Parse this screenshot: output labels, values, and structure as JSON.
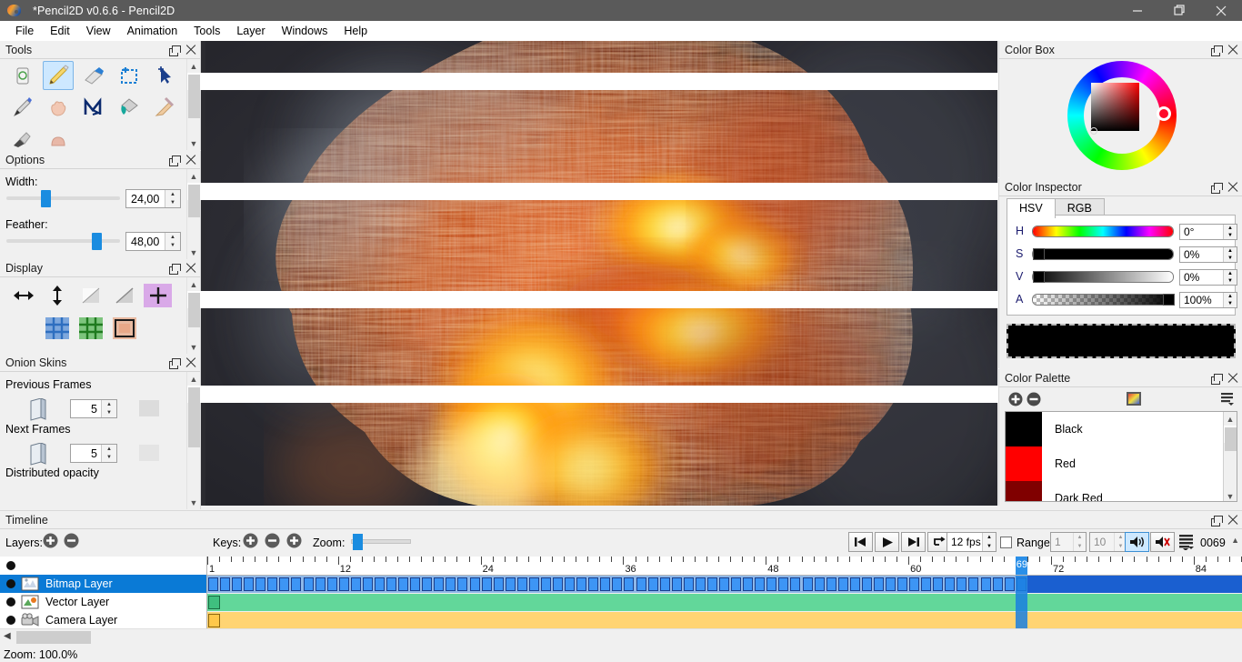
{
  "window": {
    "title": "*Pencil2D v0.6.6 - Pencil2D",
    "minimize_label": "minimize",
    "maximize_label": "restore",
    "close_label": "close"
  },
  "menubar": {
    "items": [
      {
        "label": "File"
      },
      {
        "label": "Edit"
      },
      {
        "label": "View"
      },
      {
        "label": "Animation"
      },
      {
        "label": "Tools"
      },
      {
        "label": "Layer"
      },
      {
        "label": "Windows"
      },
      {
        "label": "Help"
      }
    ]
  },
  "tools_panel": {
    "title": "Tools",
    "selected": "pencil",
    "items": [
      {
        "name": "clear-tool",
        "icon": "trash-icon"
      },
      {
        "name": "pencil-tool",
        "icon": "pencil-icon"
      },
      {
        "name": "eraser-tool",
        "icon": "eraser-icon"
      },
      {
        "name": "select-tool",
        "icon": "marquee-icon"
      },
      {
        "name": "move-tool",
        "icon": "cursor-icon"
      },
      {
        "name": "pen-tool",
        "icon": "pen-nib-icon"
      },
      {
        "name": "hand-tool",
        "icon": "hand-icon"
      },
      {
        "name": "polyline-tool",
        "icon": "polyline-icon"
      },
      {
        "name": "bucket-tool",
        "icon": "paint-bucket-icon"
      },
      {
        "name": "eyedropper-tool",
        "icon": "eyedropper-icon"
      },
      {
        "name": "brush-tool",
        "icon": "brush-icon"
      },
      {
        "name": "smudge-tool",
        "icon": "smudge-icon"
      }
    ]
  },
  "options_panel": {
    "title": "Options",
    "width_label": "Width:",
    "width_value": "24,00",
    "width_percent": 22,
    "feather_label": "Feather:",
    "feather_value": "48,00",
    "feather_percent": 74
  },
  "display_panel": {
    "title": "Display",
    "row1": [
      {
        "name": "flip-horizontal-button",
        "icon": "arrows-horizontal-icon",
        "active": false
      },
      {
        "name": "flip-vertical-button",
        "icon": "arrows-vertical-icon",
        "active": false
      },
      {
        "name": "mirror-button",
        "icon": "triangle-light-icon",
        "active": false
      },
      {
        "name": "mirror-diagonal-button",
        "icon": "triangle-line-icon",
        "active": false
      },
      {
        "name": "center-cross-button",
        "icon": "plus-icon",
        "active": true
      }
    ],
    "row2": [
      {
        "name": "grid-blue-button",
        "icon": "grid-blue-icon",
        "active": false
      },
      {
        "name": "grid-green-button",
        "icon": "grid-green-icon",
        "active": false
      },
      {
        "name": "safe-area-button",
        "icon": "frame-icon",
        "active": false
      }
    ]
  },
  "onion_panel": {
    "title": "Onion Skins",
    "previous_label": "Previous Frames",
    "previous_value": "5",
    "next_label": "Next Frames",
    "next_value": "5",
    "distributed_label": "Distributed opacity"
  },
  "color_box": {
    "title": "Color Box",
    "hue_marker_color": "#ff0a2a"
  },
  "color_inspector": {
    "title": "Color Inspector",
    "tabs": [
      {
        "label": "HSV",
        "active": true
      },
      {
        "label": "RGB",
        "active": false
      }
    ],
    "rows": [
      {
        "key": "H",
        "value": "0°",
        "kind": "hue"
      },
      {
        "key": "S",
        "value": "0%",
        "kind": "sat"
      },
      {
        "key": "V",
        "value": "0%",
        "kind": "val"
      },
      {
        "key": "A",
        "value": "100%",
        "kind": "alpha"
      }
    ],
    "preview_color": "#000000"
  },
  "color_palette": {
    "title": "Color Palette",
    "add_label": "add-color",
    "remove_label": "remove-color",
    "colors": [
      {
        "name": "Black",
        "hex": "#000000"
      },
      {
        "name": "Red",
        "hex": "#ff0000"
      },
      {
        "name": "Dark Red",
        "hex": "#800000"
      }
    ]
  },
  "timeline": {
    "title": "Timeline",
    "layers_label": "Layers:",
    "keys_label": "Keys:",
    "zoom_label": "Zoom:",
    "zoom_percent": 5,
    "fps_value": "12 fps",
    "range_label": "Range",
    "range_checked": false,
    "range_start": "1",
    "range_end": "10",
    "frame_counter": "0069",
    "current_frame": 69,
    "sound_on": true,
    "ruler_marks": [
      "1",
      "12",
      "24",
      "36",
      "48",
      "60",
      "72",
      "84"
    ],
    "layers": [
      {
        "name": "Bitmap Layer",
        "icon": "bitmap-layer-icon",
        "selected": true,
        "visible": true,
        "track_color": "#3d95f5",
        "kind": "keyframes"
      },
      {
        "name": "Vector Layer",
        "icon": "vector-layer-icon",
        "selected": false,
        "visible": true,
        "track_color": "#62d79a",
        "kind": "single"
      },
      {
        "name": "Camera Layer",
        "icon": "camera-layer-icon",
        "selected": false,
        "visible": true,
        "track_color": "#ffd473",
        "kind": "single"
      }
    ],
    "playback_buttons": [
      {
        "name": "play-backwards-button",
        "icon": "step-back-icon"
      },
      {
        "name": "play-button",
        "icon": "play-icon"
      },
      {
        "name": "play-forward-button",
        "icon": "step-forward-icon"
      },
      {
        "name": "loop-button",
        "icon": "loop-icon"
      }
    ]
  },
  "statusbar": {
    "zoom_text": "Zoom: 100.0%"
  }
}
